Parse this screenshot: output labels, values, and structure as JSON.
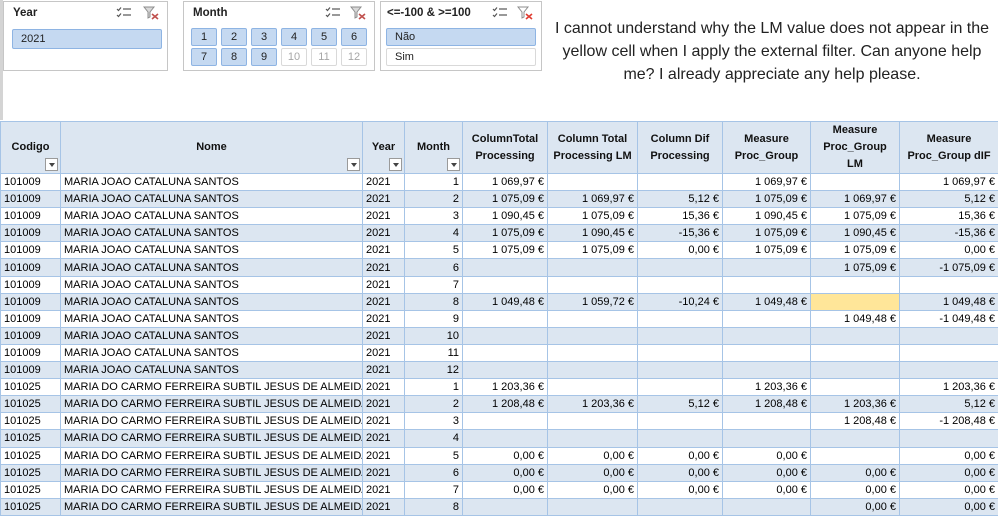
{
  "slicers": {
    "year": {
      "title": "Year",
      "items": [
        "2021"
      ]
    },
    "month": {
      "title": "Month",
      "items": [
        {
          "label": "1",
          "state": "on"
        },
        {
          "label": "2",
          "state": "on"
        },
        {
          "label": "3",
          "state": "on"
        },
        {
          "label": "4",
          "state": "on"
        },
        {
          "label": "5",
          "state": "on"
        },
        {
          "label": "6",
          "state": "on"
        },
        {
          "label": "7",
          "state": "on"
        },
        {
          "label": "8",
          "state": "on"
        },
        {
          "label": "9",
          "state": "on"
        },
        {
          "label": "10",
          "state": "off"
        },
        {
          "label": "11",
          "state": "off"
        },
        {
          "label": "12",
          "state": "off"
        }
      ]
    },
    "range": {
      "title": "<=-100 & >=100",
      "items": [
        {
          "label": "Não",
          "state": "on"
        },
        {
          "label": "Sim",
          "state": "plain"
        }
      ]
    }
  },
  "question": "I cannot understand why the LM value does not appear in the yellow cell when I apply the external filter. Can anyone help me? I already appreciate any help please.",
  "table": {
    "headers": [
      "Codigo",
      "Nome",
      "Year",
      "Month",
      "ColumnTotal Processing",
      "Column Total Processing LM",
      "Column Dif Processing",
      "Measure Proc_Group",
      "Measure Proc_Group LM",
      "Measure Proc_Group dIF"
    ],
    "rows": [
      [
        "101009",
        "MARIA JOAO CATALUNA SANTOS",
        "2021",
        "1",
        "1 069,97 €",
        "",
        "",
        "1 069,97 €",
        "",
        "1 069,97 €"
      ],
      [
        "101009",
        "MARIA JOAO CATALUNA SANTOS",
        "2021",
        "2",
        "1 075,09 €",
        "1 069,97 €",
        "5,12 €",
        "1 075,09 €",
        "1 069,97 €",
        "5,12 €"
      ],
      [
        "101009",
        "MARIA JOAO CATALUNA SANTOS",
        "2021",
        "3",
        "1 090,45 €",
        "1 075,09 €",
        "15,36 €",
        "1 090,45 €",
        "1 075,09 €",
        "15,36 €"
      ],
      [
        "101009",
        "MARIA JOAO CATALUNA SANTOS",
        "2021",
        "4",
        "1 075,09 €",
        "1 090,45 €",
        "-15,36 €",
        "1 075,09 €",
        "1 090,45 €",
        "-15,36 €"
      ],
      [
        "101009",
        "MARIA JOAO CATALUNA SANTOS",
        "2021",
        "5",
        "1 075,09 €",
        "1 075,09 €",
        "0,00 €",
        "1 075,09 €",
        "1 075,09 €",
        "0,00 €"
      ],
      [
        "101009",
        "MARIA JOAO CATALUNA SANTOS",
        "2021",
        "6",
        "",
        "",
        "",
        "",
        "1 075,09 €",
        "-1 075,09 €"
      ],
      [
        "101009",
        "MARIA JOAO CATALUNA SANTOS",
        "2021",
        "7",
        "",
        "",
        "",
        "",
        "",
        ""
      ],
      [
        "101009",
        "MARIA JOAO CATALUNA SANTOS",
        "2021",
        "8",
        "1 049,48 €",
        "1 059,72 €",
        "-10,24 €",
        "1 049,48 €",
        "",
        "1 049,48 €"
      ],
      [
        "101009",
        "MARIA JOAO CATALUNA SANTOS",
        "2021",
        "9",
        "",
        "",
        "",
        "",
        "1 049,48 €",
        "-1 049,48 €"
      ],
      [
        "101009",
        "MARIA JOAO CATALUNA SANTOS",
        "2021",
        "10",
        "",
        "",
        "",
        "",
        "",
        ""
      ],
      [
        "101009",
        "MARIA JOAO CATALUNA SANTOS",
        "2021",
        "11",
        "",
        "",
        "",
        "",
        "",
        ""
      ],
      [
        "101009",
        "MARIA JOAO CATALUNA SANTOS",
        "2021",
        "12",
        "",
        "",
        "",
        "",
        "",
        ""
      ],
      [
        "101025",
        "MARIA DO CARMO FERREIRA SUBTIL JESUS DE ALMEIDA",
        "2021",
        "1",
        "1 203,36 €",
        "",
        "",
        "1 203,36 €",
        "",
        "1 203,36 €"
      ],
      [
        "101025",
        "MARIA DO CARMO FERREIRA SUBTIL JESUS DE ALMEIDA",
        "2021",
        "2",
        "1 208,48 €",
        "1 203,36 €",
        "5,12 €",
        "1 208,48 €",
        "1 203,36 €",
        "5,12 €"
      ],
      [
        "101025",
        "MARIA DO CARMO FERREIRA SUBTIL JESUS DE ALMEIDA",
        "2021",
        "3",
        "",
        "",
        "",
        "",
        "1 208,48 €",
        "-1 208,48 €"
      ],
      [
        "101025",
        "MARIA DO CARMO FERREIRA SUBTIL JESUS DE ALMEIDA",
        "2021",
        "4",
        "",
        "",
        "",
        "",
        "",
        ""
      ],
      [
        "101025",
        "MARIA DO CARMO FERREIRA SUBTIL JESUS DE ALMEIDA",
        "2021",
        "5",
        "0,00 €",
        "0,00 €",
        "0,00 €",
        "0,00 €",
        "",
        "0,00 €"
      ],
      [
        "101025",
        "MARIA DO CARMO FERREIRA SUBTIL JESUS DE ALMEIDA",
        "2021",
        "6",
        "0,00 €",
        "0,00 €",
        "0,00 €",
        "0,00 €",
        "0,00 €",
        "0,00 €"
      ],
      [
        "101025",
        "MARIA DO CARMO FERREIRA SUBTIL JESUS DE ALMEIDA",
        "2021",
        "7",
        "0,00 €",
        "0,00 €",
        "0,00 €",
        "0,00 €",
        "0,00 €",
        "0,00 €"
      ],
      [
        "101025",
        "MARIA DO CARMO FERREIRA SUBTIL JESUS DE ALMEIDA",
        "2021",
        "8",
        "",
        "",
        "",
        "",
        "0,00 €",
        "0,00 €"
      ]
    ],
    "highlight": {
      "row": 7,
      "col": 8,
      "color": "#ffe699"
    }
  },
  "icons": {
    "multi_select": "multi-select-icon",
    "clear_filter": "clear-filter-icon",
    "filter_dropdown": "filter-dropdown-icon"
  },
  "colors": {
    "header_fill": "#dce6f1",
    "band_fill": "#dce6f1",
    "slicer_selected": "#c5d9f1",
    "highlight": "#ffe699"
  }
}
